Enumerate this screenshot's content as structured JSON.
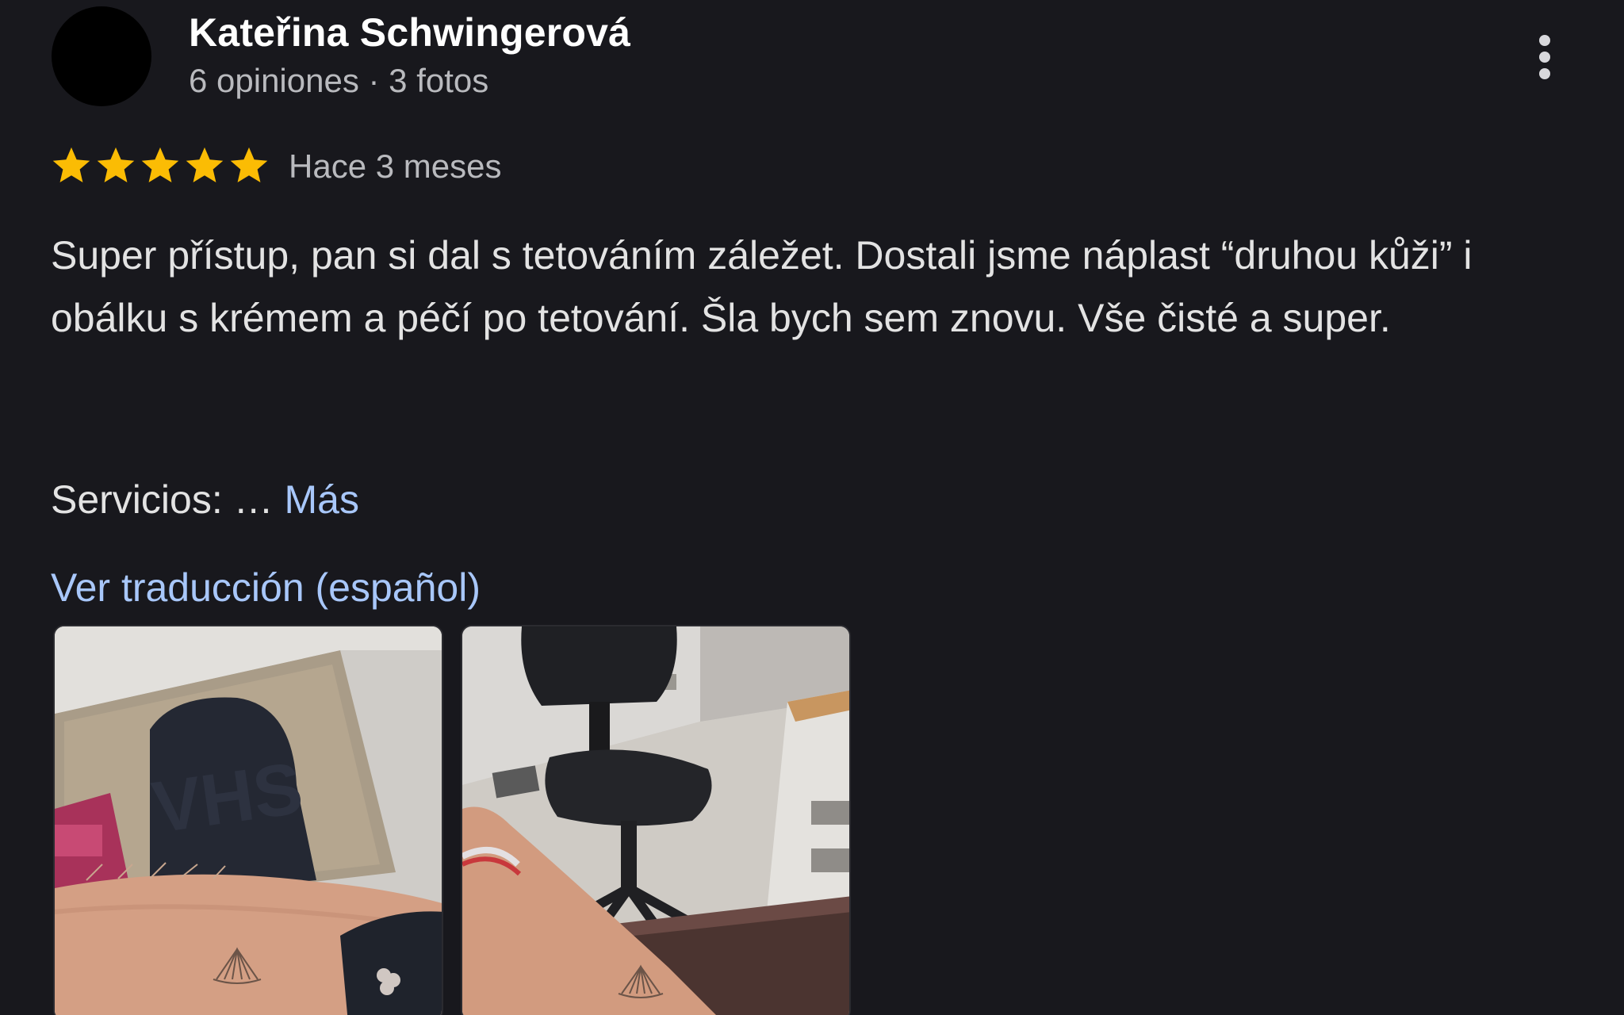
{
  "review": {
    "author": {
      "name": "Kateřina Schwingerová",
      "meta": "6 opiniones · 3 fotos",
      "avatar_color": "#000000"
    },
    "rating": 5,
    "max_rating": 5,
    "star_color": "#fbbc04",
    "date": "Hace 3 meses",
    "text": "Super přístup, pan si dal s tetováním záležet. Dostali jsme náplast “druhou kůži” i obálku s krémem a péčí po tetování. Šla bych sem znovu. Vše čisté a super.",
    "services_label": "Servicios: … ",
    "more_label": "Más",
    "translate_label": "Ver traducción (español)",
    "link_color": "#a8c7fa",
    "menu_icon": "more-vert-icon",
    "photos": [
      {
        "name": "review-photo-1"
      },
      {
        "name": "review-photo-2"
      }
    ]
  }
}
